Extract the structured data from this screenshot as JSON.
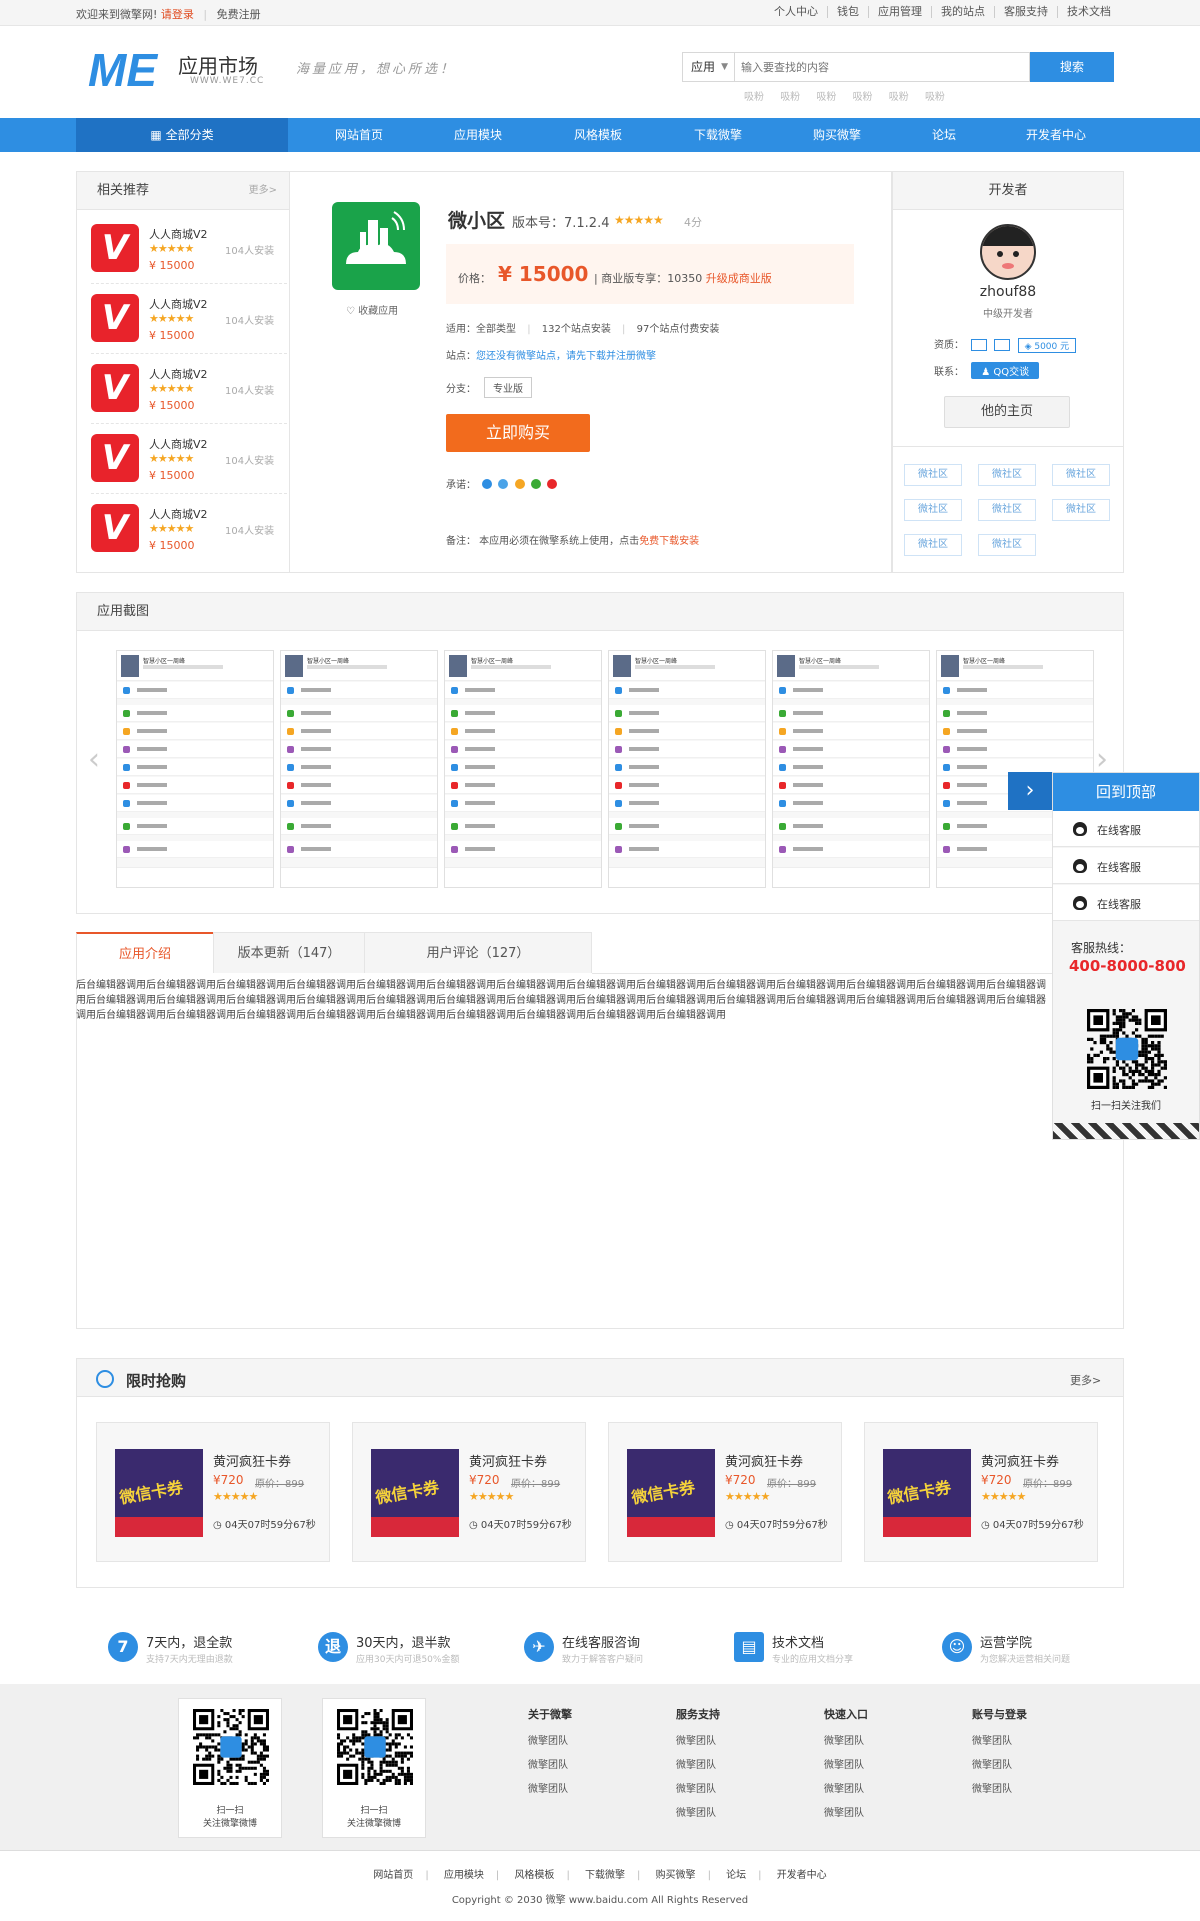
{
  "topbar": {
    "welcome": "欢迎来到微擎网!",
    "login": "请登录",
    "register": "免费注册",
    "links": [
      "个人中心",
      "钱包",
      "应用管理",
      "我的站点",
      "客服支持",
      "技术文档"
    ]
  },
  "header": {
    "logo_title": "应用市场",
    "logo_sub": "WWW.WE7.CC",
    "slogan": "海量应用，想心所选！",
    "search_type": "应用",
    "search_placeholder": "输入要查找的内容",
    "search_button": "搜索",
    "hot_words": [
      "吸粉",
      "吸粉",
      "吸粉",
      "吸粉",
      "吸粉",
      "吸粉"
    ]
  },
  "nav": {
    "all": "全部分类",
    "items": [
      "网站首页",
      "应用模块",
      "风格模板",
      "下载微擎",
      "购买微擎",
      "论坛",
      "开发者中心"
    ]
  },
  "related": {
    "title": "相关推荐",
    "more": "更多>",
    "items": [
      {
        "name": "人人商城V2",
        "installs": "104人安装",
        "price": "¥ 15000"
      },
      {
        "name": "人人商城V2",
        "installs": "104人安装",
        "price": "¥ 15000"
      },
      {
        "name": "人人商城V2",
        "installs": "104人安装",
        "price": "¥ 15000"
      },
      {
        "name": "人人商城V2",
        "installs": "104人安装",
        "price": "¥ 15000"
      },
      {
        "name": "人人商城V2",
        "installs": "104人安装",
        "price": "¥ 15000"
      }
    ]
  },
  "app": {
    "name": "微小区",
    "version": "版本号：7.1.2.4",
    "rating": 5,
    "score": "4分",
    "favorite": "收藏应用",
    "price_label": "价格：",
    "price": "¥ 15000",
    "enterprise": "商业版专享：10350",
    "upgrade": "升级成商业版",
    "suitable": "适用：全部类型",
    "installs": "132个站点安装",
    "paid": "97个站点付费安装",
    "site_label": "站点：",
    "site_text": "您还没有微擎站点，请先下载并注册微擎",
    "branch_label": "分支：",
    "branch": "专业版",
    "buy": "立即购买",
    "promise_label": "承诺：",
    "note_prefix": "备注：  本应用必须在微擎系统上使用，点击",
    "note_link": "免费下载安装"
  },
  "developer": {
    "title": "开发者",
    "name": "zhouf88",
    "level": "中级开发者",
    "qual_label": "资质：",
    "bond": "5000 元",
    "contact_label": "联系：",
    "qq": "QQ交谈",
    "home": "他的主页",
    "tags": [
      "微社区",
      "微社区",
      "微社区",
      "微社区",
      "微社区",
      "微社区",
      "微社区",
      "微社区"
    ]
  },
  "screenshots": {
    "title": "应用截图",
    "shot_title": "智慧小区一周峰"
  },
  "tabs": [
    "应用介绍",
    "版本更新（147）",
    "用户评论（127）"
  ],
  "intro": "后台编辑器调用后台编辑器调用后台编辑器调用后台编辑器调用后台编辑器调用后台编辑器调用后台编辑器调用后台编辑器调用后台编辑器调用后台编辑器调用后台编辑器调用后台编辑器调用后台编辑器调用后台编辑器调用后台编辑器调用后台编辑器调用后台编辑器调用后台编辑器调用后台编辑器调用后台编辑器调用后台编辑器调用后台编辑器调用后台编辑器调用后台编辑器调用后台编辑器调用后台编辑器调用后台编辑器调用后台编辑器调用后台编辑器调用后台编辑器调用后台编辑器调用后台编辑器调用后台编辑器调用后台编辑器调用后台编辑器调用后台编辑器调用后台编辑器调用",
  "flash": {
    "title": "限时抢购",
    "more": "更多>",
    "cards": [
      {
        "name": "黄河疯狂卡券",
        "price": "¥720",
        "old": "原价：899",
        "countdown": "04天07时59分67秒",
        "img_text": "微信卡券"
      },
      {
        "name": "黄河疯狂卡券",
        "price": "¥720",
        "old": "原价：899",
        "countdown": "04天07时59分67秒",
        "img_text": "微信卡券"
      },
      {
        "name": "黄河疯狂卡券",
        "price": "¥720",
        "old": "原价：899",
        "countdown": "04天07时59分67秒",
        "img_text": "微信卡券"
      },
      {
        "name": "黄河疯狂卡券",
        "price": "¥720",
        "old": "原价：899",
        "countdown": "04天07时59分67秒",
        "img_text": "微信卡券"
      }
    ]
  },
  "services": [
    {
      "icon": "7",
      "title": "7天内，退全款",
      "desc": "支持7天内无理由退款"
    },
    {
      "icon": "退",
      "title": "30天内，退半款",
      "desc": "应用30天内可退50%金额"
    },
    {
      "icon": "✈",
      "title": "在线客服咨询",
      "desc": "致力于解答客户疑问"
    },
    {
      "icon": "▤",
      "title": "技术文档",
      "desc": "专业的应用文档分享"
    },
    {
      "icon": "☺",
      "title": "运营学院",
      "desc": "为您解决运营相关问题"
    }
  ],
  "footer": {
    "qr": [
      {
        "line1": "扫一扫",
        "line2": "关注微擎微博"
      },
      {
        "line1": "扫一扫",
        "line2": "关注微擎微博"
      }
    ],
    "columns": [
      {
        "title": "关于微擎",
        "links": [
          "微擎团队",
          "微擎团队",
          "微擎团队"
        ]
      },
      {
        "title": "服务支持",
        "links": [
          "微擎团队",
          "微擎团队",
          "微擎团队",
          "微擎团队"
        ]
      },
      {
        "title": "快速入口",
        "links": [
          "微擎团队",
          "微擎团队",
          "微擎团队",
          "微擎团队"
        ]
      },
      {
        "title": "账号与登录",
        "links": [
          "微擎团队",
          "微擎团队",
          "微擎团队"
        ]
      }
    ],
    "bottom_links": [
      "网站首页",
      "应用模块",
      "风格模板",
      "下载微擎",
      "购买微擎",
      "论坛",
      "开发者中心"
    ],
    "copyright": "Copyright © 2030 微擎 www.baidu.com All Rights Reserved"
  },
  "side": {
    "back_top": "回到顶部",
    "cs": [
      "在线客服",
      "在线客服",
      "在线客服"
    ],
    "hotline_label": "客服热线：",
    "hotline": "400-8000-800",
    "qr_text": "扫一扫关注我们"
  },
  "colors": {
    "primary": "#2e8ee2",
    "accent": "#e8572a",
    "buy": "#f26b1d"
  }
}
